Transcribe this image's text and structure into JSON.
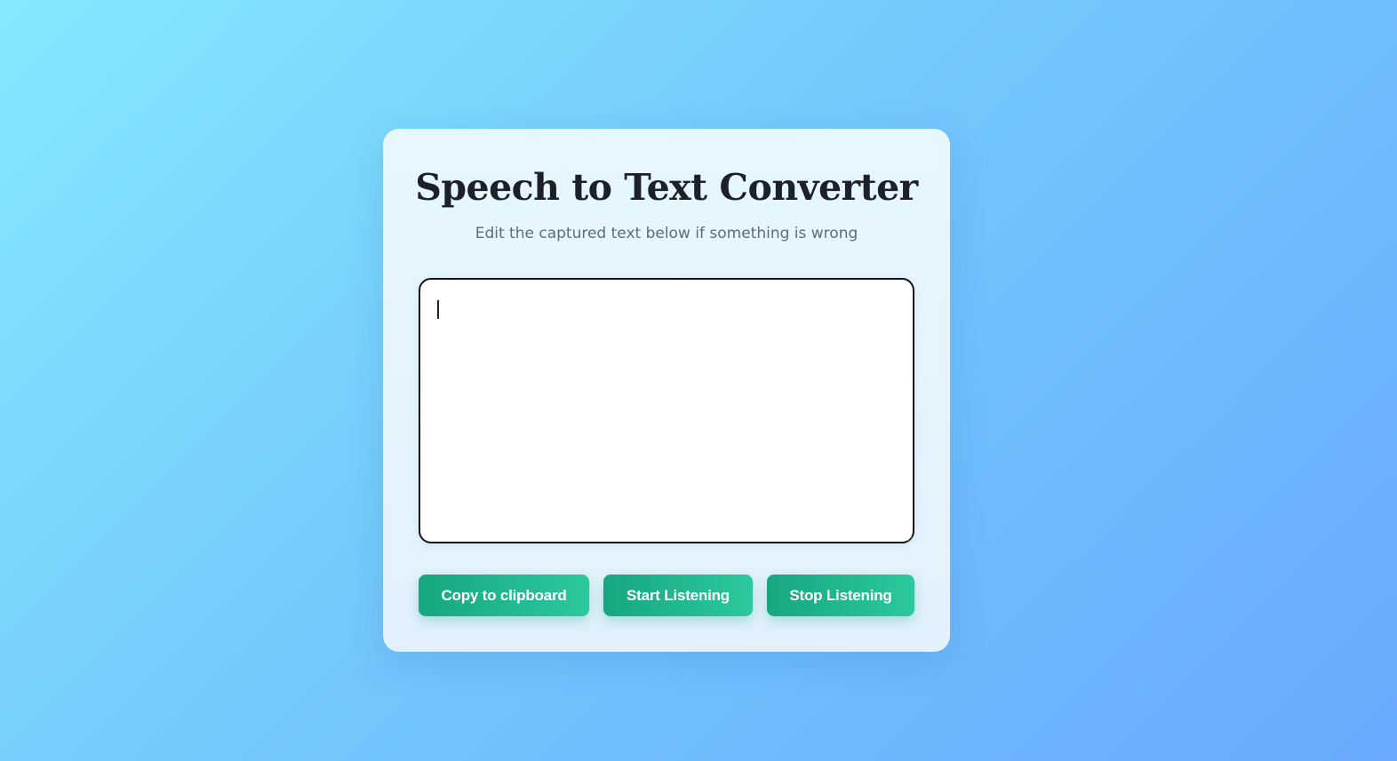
{
  "card": {
    "title": "Speech to Text Converter",
    "subtitle": "Edit the captured text below if something is wrong"
  },
  "editor": {
    "value": "",
    "placeholder": ""
  },
  "buttons": {
    "copy_label": "Copy to clipboard",
    "start_label": "Start Listening",
    "stop_label": "Stop Listening"
  },
  "colors": {
    "background_start": "#86e8fd",
    "background_end": "#68a9fd",
    "button_start": "#16a781",
    "button_end": "#2cc89e",
    "title": "#1c2028",
    "subtitle": "#5f6b78"
  }
}
